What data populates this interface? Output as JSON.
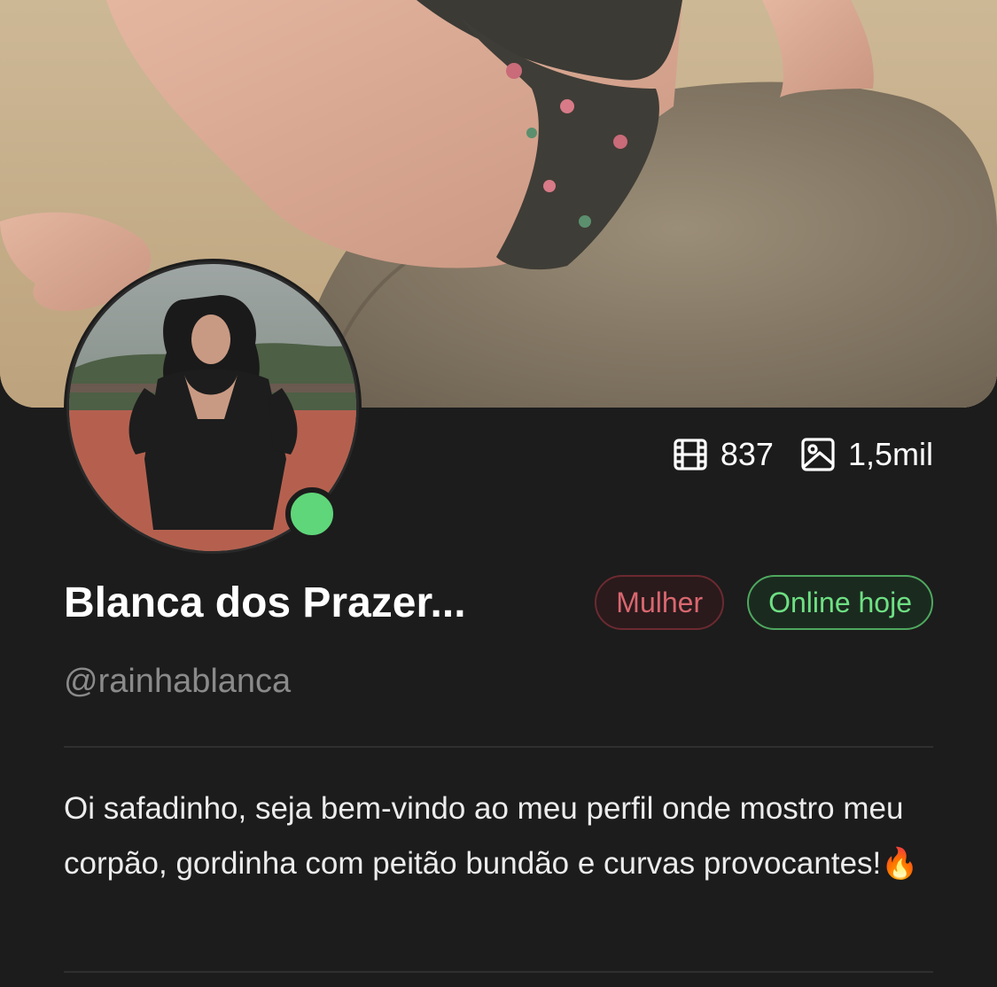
{
  "profile": {
    "name": "Blanca dos Prazer...",
    "username": "@rainhablanca",
    "gender_badge": "Mulher",
    "status_badge": "Online hoje",
    "bio": "Oi safadinho, seja bem-vindo ao meu perfil onde mostro meu corpão, gordinha com peitão bundão e curvas provocantes!",
    "bio_emoji": "🔥"
  },
  "stats": {
    "videos": "837",
    "photos": "1,5mil"
  },
  "icons": {
    "videos": "film-icon",
    "photos": "image-icon"
  },
  "colors": {
    "background": "#1c1c1c",
    "online_dot": "#5fd67a",
    "gender_badge_text": "#d9676f",
    "online_badge_text": "#6ee083",
    "username_text": "#8a8a8a"
  }
}
